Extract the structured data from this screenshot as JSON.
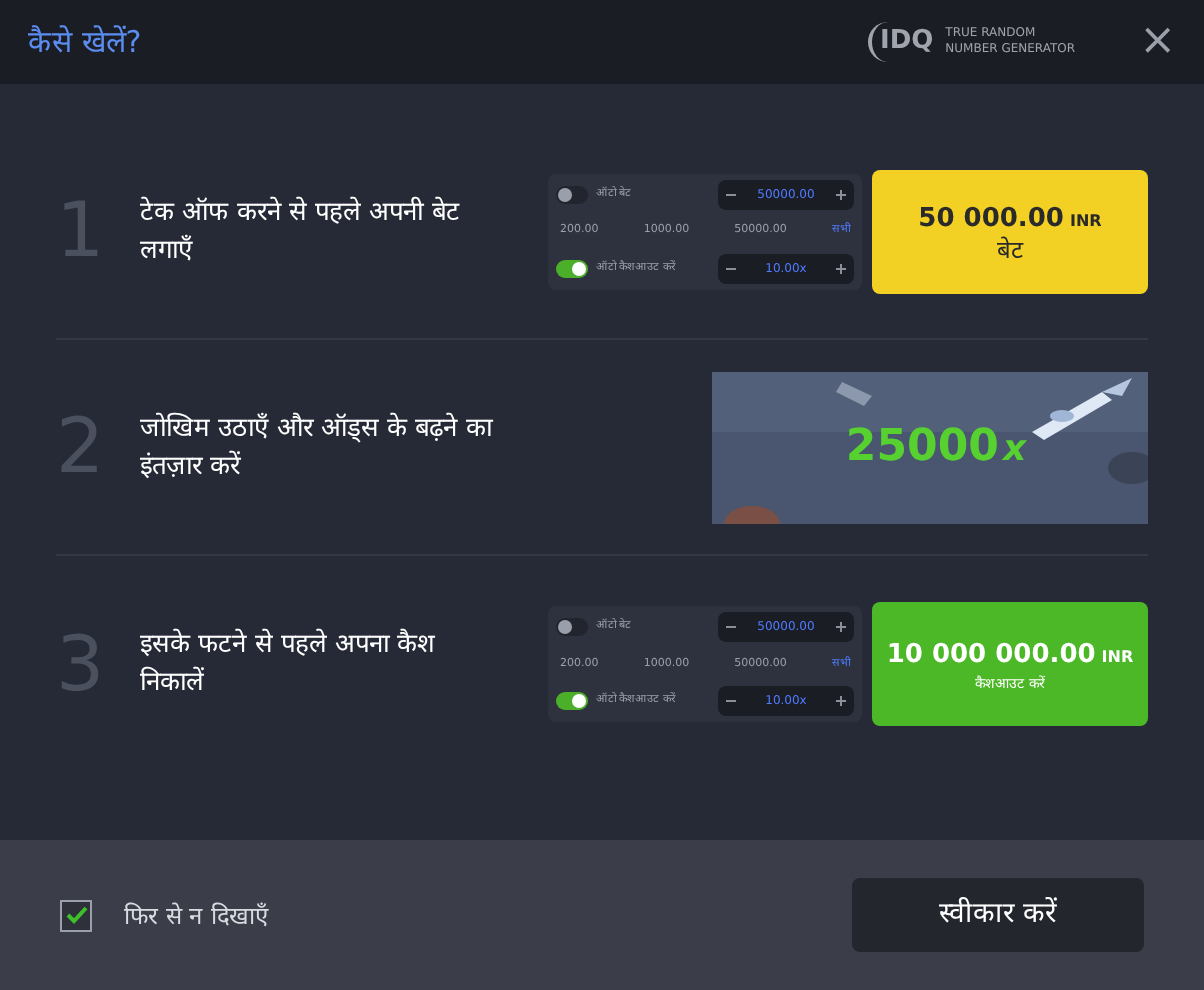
{
  "header": {
    "title": "कैसे खेलें?",
    "logo_mark": "IDQ",
    "logo_text": [
      "TRUE RANDOM",
      "NUMBER GENERATOR"
    ],
    "close": "×"
  },
  "steps": [
    {
      "kind": "bet_panel",
      "number": "1",
      "text": "टेक ऑफ करने से पहले अपनी बेट लगाएँ",
      "panel": {
        "auto_bet_label": "ऑटो बेट",
        "auto_bet_on": false,
        "bet_value": "50000.00",
        "presets": [
          "200.00",
          "1000.00",
          "50000.00"
        ],
        "all_label": "सभी",
        "auto_cashout_label": "ऑटो कैशआउट करें",
        "auto_cashout_on": true,
        "cashout_value": "10.00x"
      },
      "button": {
        "kind": "bet",
        "amount": "50 000.00",
        "currency": "INR",
        "label": "बेट"
      }
    },
    {
      "kind": "picture",
      "number": "2",
      "text": "जोखिम उठाएँ और ऑड्स के बढ़ने का इंतज़ार करें",
      "multiplier": "25000",
      "multiplier_suffix": "x"
    },
    {
      "kind": "bet_panel",
      "number": "3",
      "text": "इसके फटने से पहले अपना कैश निकालें",
      "panel": {
        "auto_bet_label": "ऑटो बेट",
        "auto_bet_on": false,
        "bet_value": "50000.00",
        "presets": [
          "200.00",
          "1000.00",
          "50000.00"
        ],
        "all_label": "सभी",
        "auto_cashout_label": "ऑटो कैशआउट करें",
        "auto_cashout_on": true,
        "cashout_value": "10.00x"
      },
      "button": {
        "kind": "cashout",
        "amount": "10 000 000.00",
        "currency": "INR",
        "label": "कैशआउट करें"
      }
    }
  ],
  "footer": {
    "dont_show_again": {
      "label": "फिर से न दिखाएँ",
      "checked": true
    },
    "accept_button": "स्वीकार करें"
  }
}
